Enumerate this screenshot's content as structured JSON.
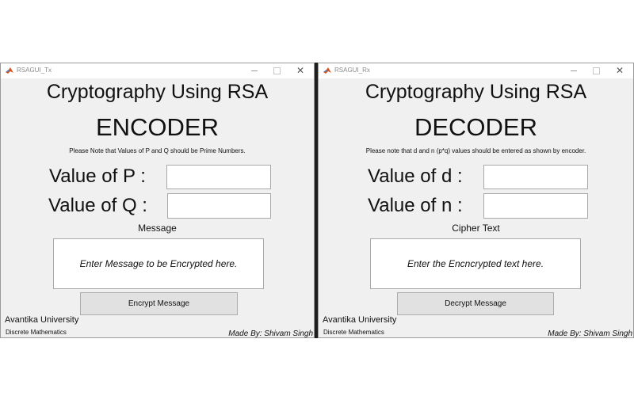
{
  "encoder": {
    "window_title": "RSAGUI_Tx",
    "heading": "Cryptography Using RSA",
    "mode": "ENCODER",
    "note": "Please Note that Values of P and Q should be Prime Numbers.",
    "field1_label": "Value of P :",
    "field1_value": "",
    "field2_label": "Value of Q :",
    "field2_value": "",
    "text_label": "Message",
    "text_placeholder": "Enter Message to be Encrypted here.",
    "button_label": "Encrypt Message",
    "university": "Avantika University",
    "department": "Discrete Mathematics",
    "credit": "Made By: Shivam Singh"
  },
  "decoder": {
    "window_title": "RSAGUI_Rx",
    "heading": "Cryptography Using RSA",
    "mode": "DECODER",
    "note": "Please note that d and n (p*q) values should be entered as shown by encoder.",
    "field1_label": "Value of d :",
    "field1_value": "",
    "field2_label": "Value of n :",
    "field2_value": "",
    "text_label": "Cipher Text",
    "text_placeholder": "Enter the Encncrypted text here.",
    "button_label": "Decrypt Message",
    "university": "Avantika University",
    "department": "Discrete Mathematics",
    "credit": "Made By: Shivam Singh"
  },
  "window_controls": {
    "close_glyph": "✕"
  },
  "colors": {
    "window_bg": "#f0f0f0",
    "button_bg": "#e1e1e1",
    "divider": "#1e1e1e"
  }
}
